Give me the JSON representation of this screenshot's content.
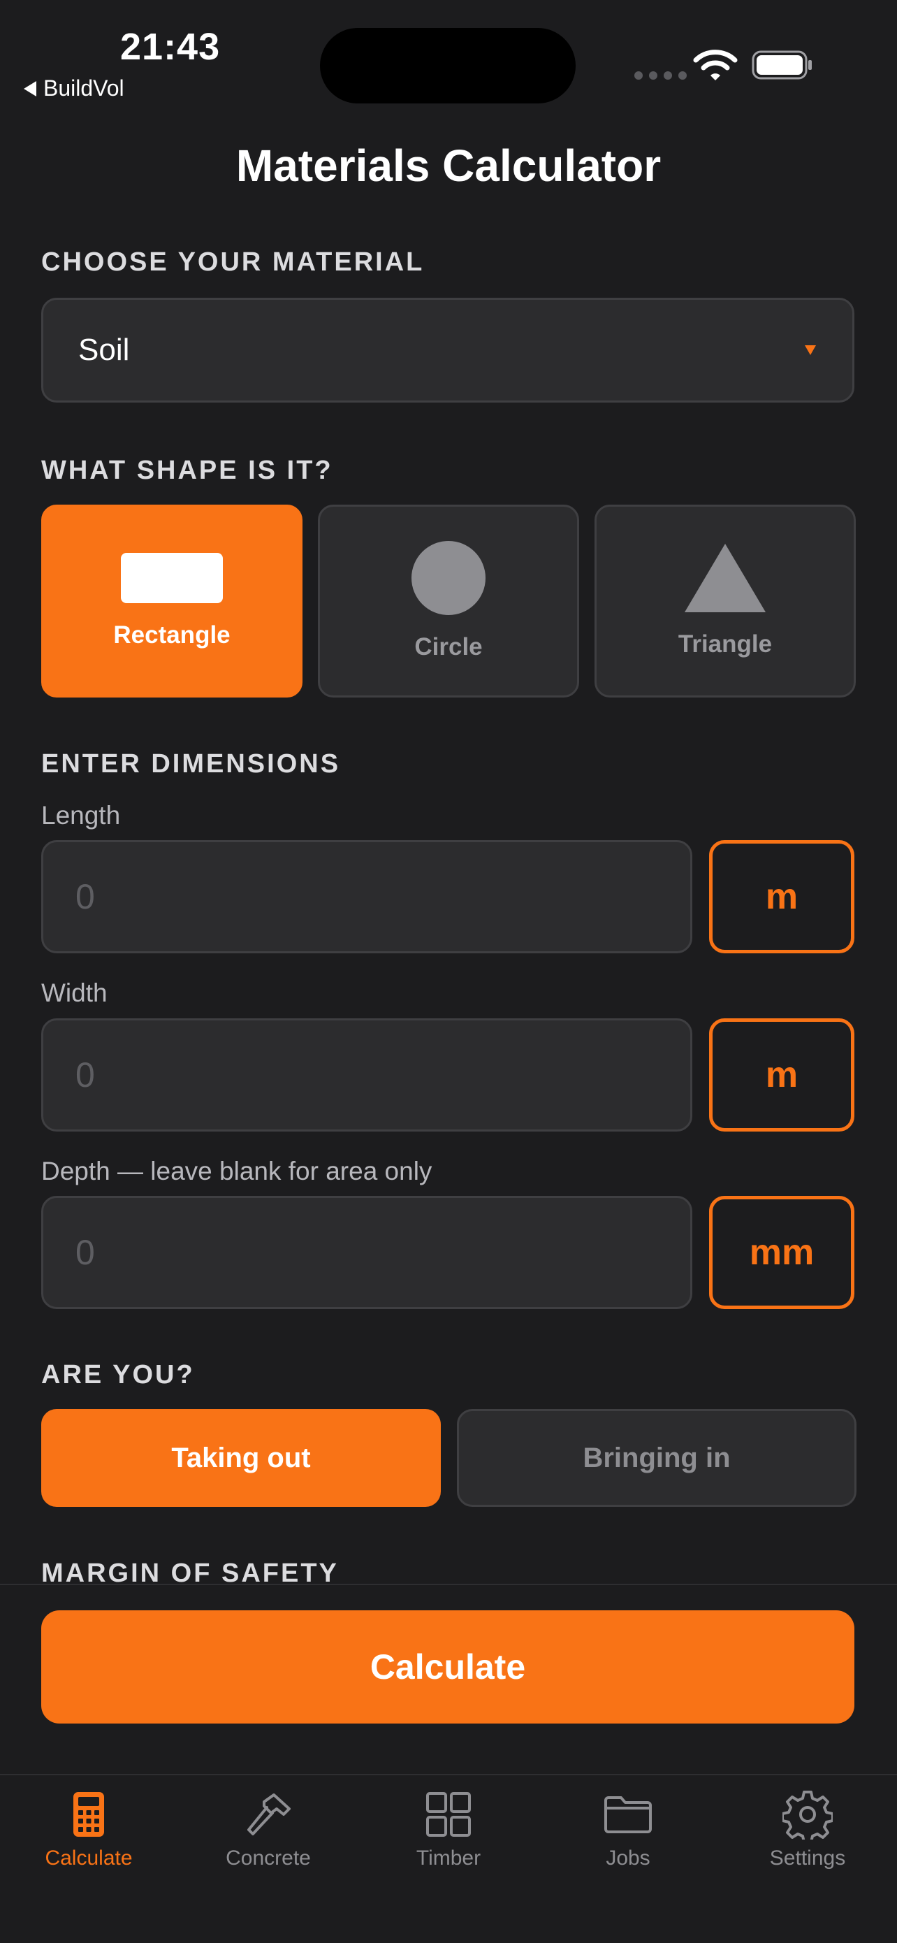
{
  "status_bar": {
    "time": "21:43",
    "back_label": "BuildVol"
  },
  "title": "Materials Calculator",
  "material": {
    "section": "CHOOSE YOUR MATERIAL",
    "selected": "Soil"
  },
  "shape": {
    "section": "WHAT SHAPE IS IT?",
    "options": [
      {
        "label": "Rectangle",
        "icon": "rectangle-icon",
        "active": true
      },
      {
        "label": "Circle",
        "icon": "circle-icon",
        "active": false
      },
      {
        "label": "Triangle",
        "icon": "triangle-icon",
        "active": false
      }
    ]
  },
  "dimensions": {
    "section": "ENTER DIMENSIONS",
    "fields": [
      {
        "label": "Length",
        "placeholder": "0",
        "unit": "m"
      },
      {
        "label": "Width",
        "placeholder": "0",
        "unit": "m"
      },
      {
        "label": "Depth — leave blank for area only",
        "placeholder": "0",
        "unit": "mm"
      }
    ]
  },
  "direction": {
    "section": "ARE YOU?",
    "options": [
      {
        "label": "Taking out",
        "active": true
      },
      {
        "label": "Bringing in",
        "active": false
      }
    ]
  },
  "margin": {
    "section": "MARGIN OF SAFETY"
  },
  "calculate_label": "Calculate",
  "tabs": [
    {
      "label": "Calculate",
      "icon": "calculator-icon",
      "active": true
    },
    {
      "label": "Concrete",
      "icon": "hammer-icon",
      "active": false
    },
    {
      "label": "Timber",
      "icon": "grid-icon",
      "active": false
    },
    {
      "label": "Jobs",
      "icon": "folder-icon",
      "active": false
    },
    {
      "label": "Settings",
      "icon": "gear-icon",
      "active": false
    }
  ],
  "colors": {
    "accent": "#f97316",
    "background": "#1c1c1e",
    "surface": "#2c2c2e",
    "muted": "#8e8e92"
  }
}
